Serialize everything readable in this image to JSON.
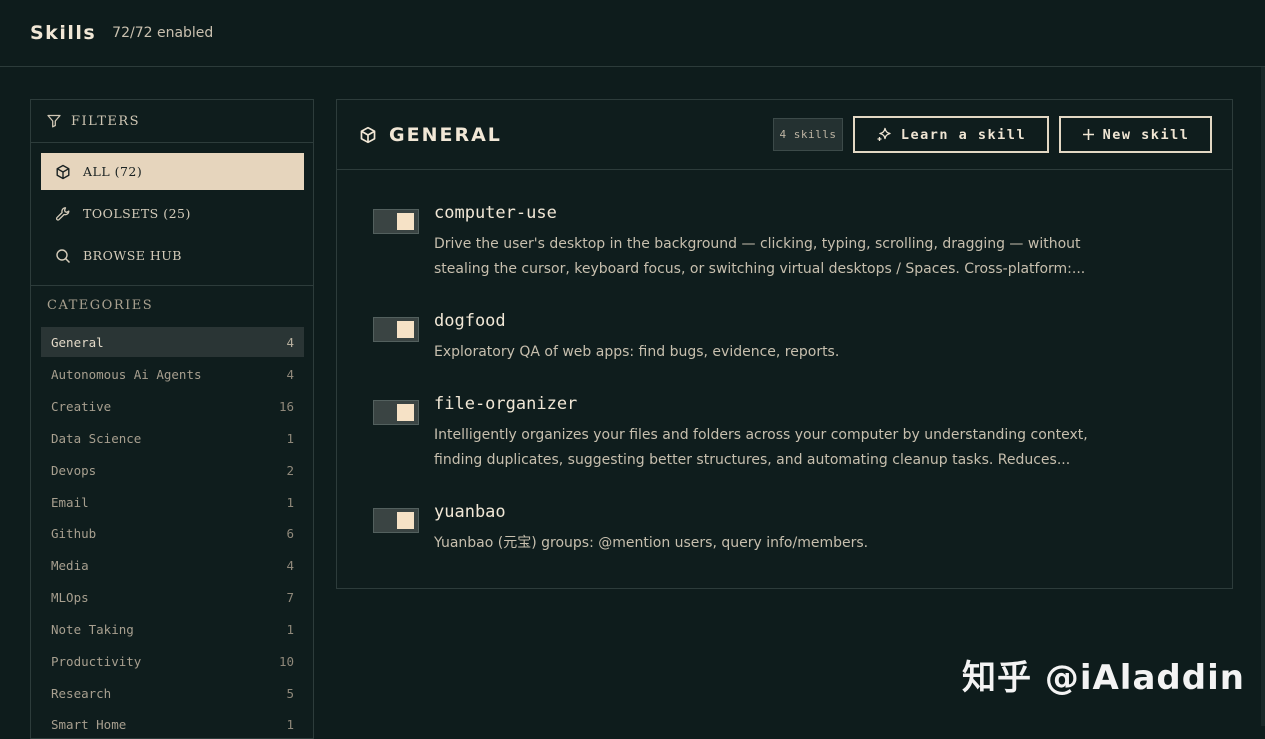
{
  "header": {
    "title": "Skills",
    "enabled_text": "72/72 enabled"
  },
  "filters": {
    "heading": "FILTERS",
    "items": [
      {
        "label": "ALL (72)",
        "icon": "cube-icon",
        "active": true
      },
      {
        "label": "TOOLSETS (25)",
        "icon": "wrench-icon",
        "active": false
      },
      {
        "label": "BROWSE HUB",
        "icon": "search-icon",
        "active": false
      }
    ]
  },
  "categories": {
    "heading": "CATEGORIES",
    "items": [
      {
        "name": "General",
        "count": "4",
        "active": true
      },
      {
        "name": "Autonomous Ai Agents",
        "count": "4"
      },
      {
        "name": "Creative",
        "count": "16"
      },
      {
        "name": "Data Science",
        "count": "1"
      },
      {
        "name": "Devops",
        "count": "2"
      },
      {
        "name": "Email",
        "count": "1"
      },
      {
        "name": "Github",
        "count": "6"
      },
      {
        "name": "Media",
        "count": "4"
      },
      {
        "name": "MLOps",
        "count": "7"
      },
      {
        "name": "Note Taking",
        "count": "1"
      },
      {
        "name": "Productivity",
        "count": "10"
      },
      {
        "name": "Research",
        "count": "5"
      },
      {
        "name": "Smart Home",
        "count": "1"
      }
    ]
  },
  "panel": {
    "title": "GENERAL",
    "skill_count": "4 skills",
    "learn_label": "Learn a skill",
    "new_label": "New skill",
    "skills": [
      {
        "name": "computer-use",
        "enabled": true,
        "desc_1": "Drive the user's desktop in the background — clicking, typing, scrolling, dragging — without",
        "desc_2": "stealing the cursor, keyboard focus, or switching virtual desktops / Spaces. Cross-platform:..."
      },
      {
        "name": "dogfood",
        "enabled": true,
        "desc_1": "Exploratory QA of web apps: find bugs, evidence, reports.",
        "desc_2": ""
      },
      {
        "name": "file-organizer",
        "enabled": true,
        "desc_1": "Intelligently organizes your files and folders across your computer by understanding context,",
        "desc_2": "finding duplicates, suggesting better structures, and automating cleanup tasks. Reduces..."
      },
      {
        "name": "yuanbao",
        "enabled": true,
        "desc_1": "Yuanbao (元宝) groups: @mention users, query info/members.",
        "desc_2": ""
      }
    ]
  },
  "watermark": {
    "text": "知乎 @iAladdin"
  },
  "colors": {
    "background": "#0e1c1c",
    "accent": "#e6d5bd",
    "toggle_knob": "#f6e2c6"
  }
}
